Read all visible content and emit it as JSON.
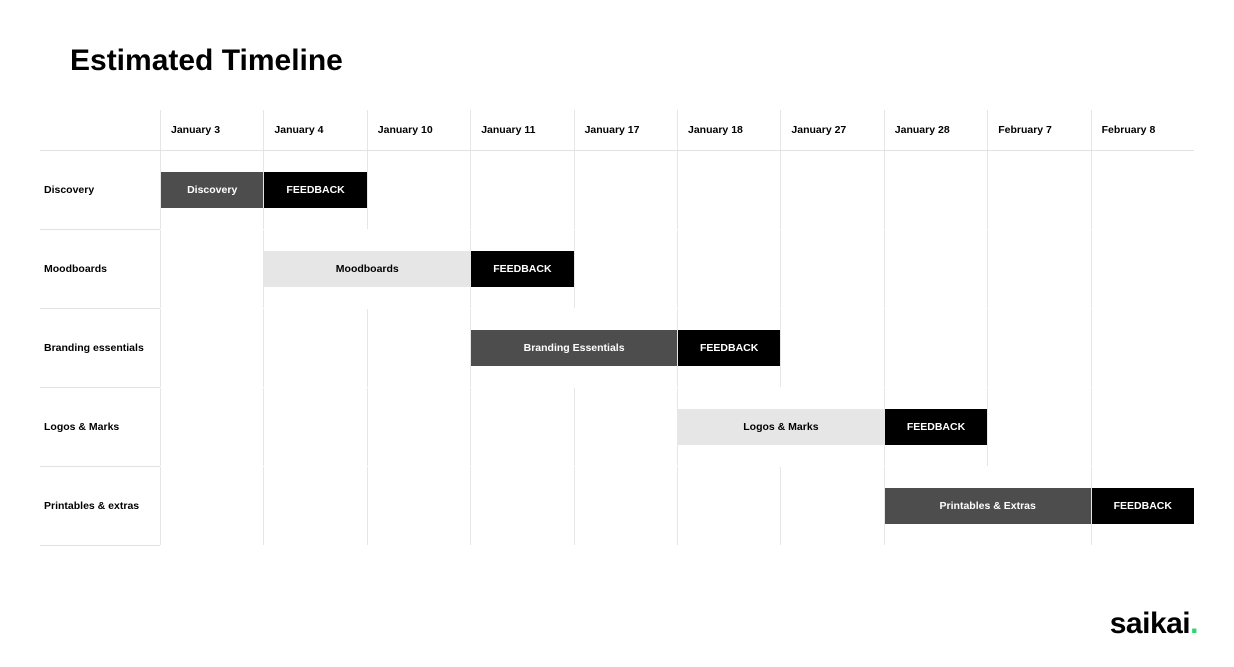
{
  "title": "Estimated Timeline",
  "columns": [
    "January 3",
    "January 4",
    "January 10",
    "January 11",
    "January 17",
    "January 18",
    "January 27",
    "January 28",
    "February 7",
    "February 8"
  ],
  "rows": [
    {
      "label": "Discovery",
      "bars": [
        {
          "label": "Discovery",
          "start": 0,
          "span": 1,
          "style": "darkgray"
        },
        {
          "label": "FEEDBACK",
          "start": 1,
          "span": 1,
          "style": "black"
        }
      ]
    },
    {
      "label": "Moodboards",
      "bars": [
        {
          "label": "Moodboards",
          "start": 1,
          "span": 2,
          "style": "lightgray"
        },
        {
          "label": "FEEDBACK",
          "start": 3,
          "span": 1,
          "style": "black"
        }
      ]
    },
    {
      "label": "Branding essentials",
      "bars": [
        {
          "label": "Branding Essentials",
          "start": 3,
          "span": 2,
          "style": "darkgray"
        },
        {
          "label": "FEEDBACK",
          "start": 5,
          "span": 1,
          "style": "black"
        }
      ]
    },
    {
      "label": "Logos & Marks",
      "bars": [
        {
          "label": "Logos & Marks",
          "start": 5,
          "span": 2,
          "style": "lightgray"
        },
        {
          "label": "FEEDBACK",
          "start": 7,
          "span": 1,
          "style": "black"
        }
      ]
    },
    {
      "label": "Printables & extras",
      "bars": [
        {
          "label": "Printables & Extras",
          "start": 7,
          "span": 2,
          "style": "darkgray"
        },
        {
          "label": "FEEDBACK",
          "start": 9,
          "span": 1,
          "style": "black"
        }
      ]
    }
  ],
  "logo": {
    "text": "saikai",
    "dot": "."
  },
  "chart_data": {
    "type": "table",
    "title": "Estimated Timeline",
    "columns": [
      "January 3",
      "January 4",
      "January 10",
      "January 11",
      "January 17",
      "January 18",
      "January 27",
      "January 28",
      "February 7",
      "February 8"
    ],
    "rows": [
      {
        "phase": "Discovery",
        "task": {
          "label": "Discovery",
          "from": "January 3",
          "to": "January 3"
        },
        "feedback": {
          "from": "January 4",
          "to": "January 4"
        }
      },
      {
        "phase": "Moodboards",
        "task": {
          "label": "Moodboards",
          "from": "January 4",
          "to": "January 10"
        },
        "feedback": {
          "from": "January 11",
          "to": "January 11"
        }
      },
      {
        "phase": "Branding essentials",
        "task": {
          "label": "Branding Essentials",
          "from": "January 11",
          "to": "January 17"
        },
        "feedback": {
          "from": "January 18",
          "to": "January 18"
        }
      },
      {
        "phase": "Logos & Marks",
        "task": {
          "label": "Logos & Marks",
          "from": "January 18",
          "to": "January 27"
        },
        "feedback": {
          "from": "January 28",
          "to": "January 28"
        }
      },
      {
        "phase": "Printables & extras",
        "task": {
          "label": "Printables & Extras",
          "from": "January 28",
          "to": "February 7"
        },
        "feedback": {
          "from": "February 8",
          "to": "February 8"
        }
      }
    ]
  }
}
